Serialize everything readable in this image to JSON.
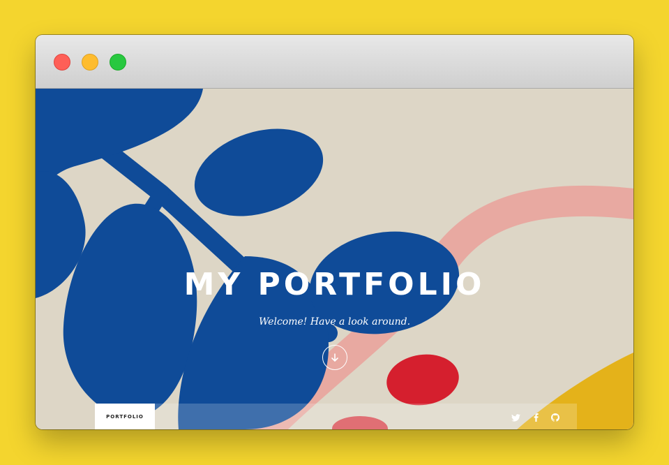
{
  "window": {
    "traffic_lights": [
      {
        "name": "close",
        "color": "#fe5f57"
      },
      {
        "name": "minimize",
        "color": "#febc2e"
      },
      {
        "name": "zoom",
        "color": "#28c840"
      }
    ]
  },
  "hero": {
    "title": "MY PORTFOLIO",
    "subtitle": "Welcome! Have a look around.",
    "scroll_icon": "arrow-down-circle-icon"
  },
  "navbar": {
    "brand": "PORTFOLIO",
    "social_icons": [
      "twitter-icon",
      "facebook-icon",
      "github-icon"
    ]
  },
  "colors": {
    "page_background": "#f4d52e",
    "art_background": "#ddd6c6",
    "leaf_blue": "#0f4b98",
    "pink_stroke": "#e8a9a1",
    "red_dot": "#d51f2e",
    "yellow_corner": "#e4b21a"
  }
}
